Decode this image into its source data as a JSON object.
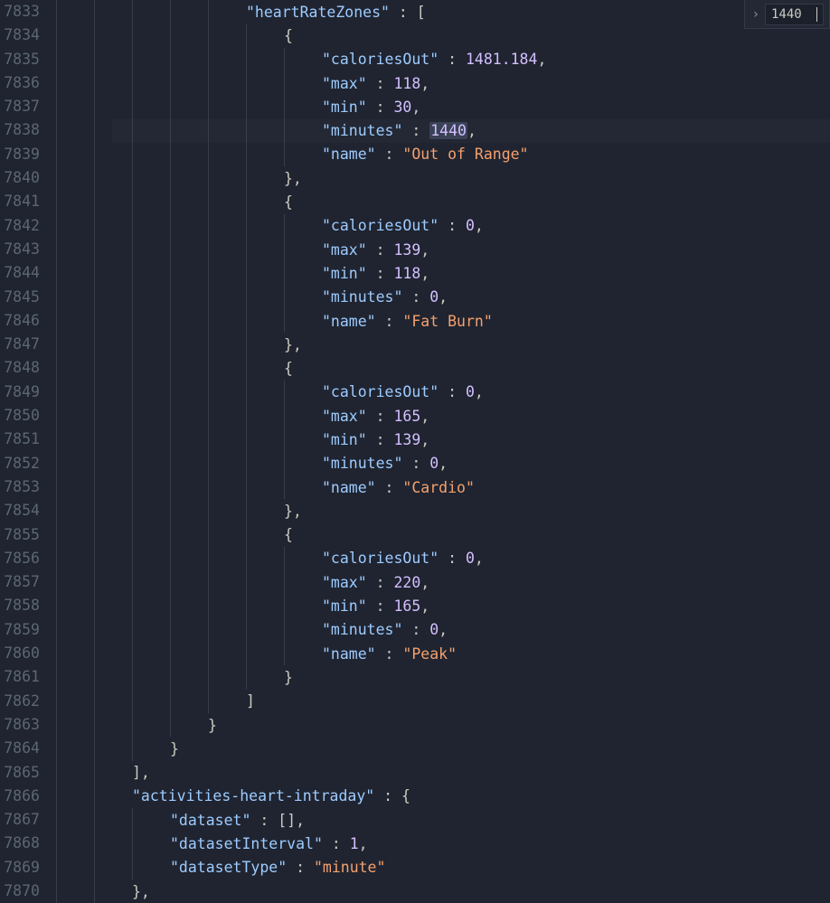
{
  "find": {
    "value": "1440"
  },
  "lines": [
    {
      "num": "7833",
      "indent": 5,
      "tokens": [
        {
          "t": "key",
          "v": "\"heartRateZones\""
        },
        {
          "t": "punc",
          "v": " : ["
        }
      ]
    },
    {
      "num": "7834",
      "indent": 6,
      "tokens": [
        {
          "t": "punc",
          "v": "{"
        }
      ]
    },
    {
      "num": "7835",
      "indent": 7,
      "tokens": [
        {
          "t": "key",
          "v": "\"caloriesOut\""
        },
        {
          "t": "punc",
          "v": " : "
        },
        {
          "t": "num",
          "v": "1481.184"
        },
        {
          "t": "punc",
          "v": ","
        }
      ]
    },
    {
      "num": "7836",
      "indent": 7,
      "tokens": [
        {
          "t": "key",
          "v": "\"max\""
        },
        {
          "t": "punc",
          "v": " : "
        },
        {
          "t": "num",
          "v": "118"
        },
        {
          "t": "punc",
          "v": ","
        }
      ]
    },
    {
      "num": "7837",
      "indent": 7,
      "tokens": [
        {
          "t": "key",
          "v": "\"min\""
        },
        {
          "t": "punc",
          "v": " : "
        },
        {
          "t": "num",
          "v": "30"
        },
        {
          "t": "punc",
          "v": ","
        }
      ]
    },
    {
      "num": "7838",
      "indent": 7,
      "highlight": true,
      "tokens": [
        {
          "t": "key",
          "v": "\"minutes\""
        },
        {
          "t": "punc",
          "v": " : "
        },
        {
          "t": "num",
          "v": "1440",
          "sel": true
        },
        {
          "t": "punc",
          "v": ","
        }
      ]
    },
    {
      "num": "7839",
      "indent": 7,
      "tokens": [
        {
          "t": "key",
          "v": "\"name\""
        },
        {
          "t": "punc",
          "v": " : "
        },
        {
          "t": "str",
          "v": "\"Out of Range\""
        }
      ]
    },
    {
      "num": "7840",
      "indent": 6,
      "tokens": [
        {
          "t": "punc",
          "v": "},"
        }
      ]
    },
    {
      "num": "7841",
      "indent": 6,
      "tokens": [
        {
          "t": "punc",
          "v": "{"
        }
      ]
    },
    {
      "num": "7842",
      "indent": 7,
      "tokens": [
        {
          "t": "key",
          "v": "\"caloriesOut\""
        },
        {
          "t": "punc",
          "v": " : "
        },
        {
          "t": "num",
          "v": "0"
        },
        {
          "t": "punc",
          "v": ","
        }
      ]
    },
    {
      "num": "7843",
      "indent": 7,
      "tokens": [
        {
          "t": "key",
          "v": "\"max\""
        },
        {
          "t": "punc",
          "v": " : "
        },
        {
          "t": "num",
          "v": "139"
        },
        {
          "t": "punc",
          "v": ","
        }
      ]
    },
    {
      "num": "7844",
      "indent": 7,
      "tokens": [
        {
          "t": "key",
          "v": "\"min\""
        },
        {
          "t": "punc",
          "v": " : "
        },
        {
          "t": "num",
          "v": "118"
        },
        {
          "t": "punc",
          "v": ","
        }
      ]
    },
    {
      "num": "7845",
      "indent": 7,
      "tokens": [
        {
          "t": "key",
          "v": "\"minutes\""
        },
        {
          "t": "punc",
          "v": " : "
        },
        {
          "t": "num",
          "v": "0"
        },
        {
          "t": "punc",
          "v": ","
        }
      ]
    },
    {
      "num": "7846",
      "indent": 7,
      "tokens": [
        {
          "t": "key",
          "v": "\"name\""
        },
        {
          "t": "punc",
          "v": " : "
        },
        {
          "t": "str",
          "v": "\"Fat Burn\""
        }
      ]
    },
    {
      "num": "7847",
      "indent": 6,
      "tokens": [
        {
          "t": "punc",
          "v": "},"
        }
      ]
    },
    {
      "num": "7848",
      "indent": 6,
      "tokens": [
        {
          "t": "punc",
          "v": "{"
        }
      ]
    },
    {
      "num": "7849",
      "indent": 7,
      "tokens": [
        {
          "t": "key",
          "v": "\"caloriesOut\""
        },
        {
          "t": "punc",
          "v": " : "
        },
        {
          "t": "num",
          "v": "0"
        },
        {
          "t": "punc",
          "v": ","
        }
      ]
    },
    {
      "num": "7850",
      "indent": 7,
      "tokens": [
        {
          "t": "key",
          "v": "\"max\""
        },
        {
          "t": "punc",
          "v": " : "
        },
        {
          "t": "num",
          "v": "165"
        },
        {
          "t": "punc",
          "v": ","
        }
      ]
    },
    {
      "num": "7851",
      "indent": 7,
      "tokens": [
        {
          "t": "key",
          "v": "\"min\""
        },
        {
          "t": "punc",
          "v": " : "
        },
        {
          "t": "num",
          "v": "139"
        },
        {
          "t": "punc",
          "v": ","
        }
      ]
    },
    {
      "num": "7852",
      "indent": 7,
      "tokens": [
        {
          "t": "key",
          "v": "\"minutes\""
        },
        {
          "t": "punc",
          "v": " : "
        },
        {
          "t": "num",
          "v": "0"
        },
        {
          "t": "punc",
          "v": ","
        }
      ]
    },
    {
      "num": "7853",
      "indent": 7,
      "tokens": [
        {
          "t": "key",
          "v": "\"name\""
        },
        {
          "t": "punc",
          "v": " : "
        },
        {
          "t": "str",
          "v": "\"Cardio\""
        }
      ]
    },
    {
      "num": "7854",
      "indent": 6,
      "tokens": [
        {
          "t": "punc",
          "v": "},"
        }
      ]
    },
    {
      "num": "7855",
      "indent": 6,
      "tokens": [
        {
          "t": "punc",
          "v": "{"
        }
      ]
    },
    {
      "num": "7856",
      "indent": 7,
      "tokens": [
        {
          "t": "key",
          "v": "\"caloriesOut\""
        },
        {
          "t": "punc",
          "v": " : "
        },
        {
          "t": "num",
          "v": "0"
        },
        {
          "t": "punc",
          "v": ","
        }
      ]
    },
    {
      "num": "7857",
      "indent": 7,
      "tokens": [
        {
          "t": "key",
          "v": "\"max\""
        },
        {
          "t": "punc",
          "v": " : "
        },
        {
          "t": "num",
          "v": "220"
        },
        {
          "t": "punc",
          "v": ","
        }
      ]
    },
    {
      "num": "7858",
      "indent": 7,
      "tokens": [
        {
          "t": "key",
          "v": "\"min\""
        },
        {
          "t": "punc",
          "v": " : "
        },
        {
          "t": "num",
          "v": "165"
        },
        {
          "t": "punc",
          "v": ","
        }
      ]
    },
    {
      "num": "7859",
      "indent": 7,
      "tokens": [
        {
          "t": "key",
          "v": "\"minutes\""
        },
        {
          "t": "punc",
          "v": " : "
        },
        {
          "t": "num",
          "v": "0"
        },
        {
          "t": "punc",
          "v": ","
        }
      ]
    },
    {
      "num": "7860",
      "indent": 7,
      "tokens": [
        {
          "t": "key",
          "v": "\"name\""
        },
        {
          "t": "punc",
          "v": " : "
        },
        {
          "t": "str",
          "v": "\"Peak\""
        }
      ]
    },
    {
      "num": "7861",
      "indent": 6,
      "tokens": [
        {
          "t": "punc",
          "v": "}"
        }
      ]
    },
    {
      "num": "7862",
      "indent": 5,
      "tokens": [
        {
          "t": "punc",
          "v": "]"
        }
      ]
    },
    {
      "num": "7863",
      "indent": 4,
      "tokens": [
        {
          "t": "punc",
          "v": "}"
        }
      ]
    },
    {
      "num": "7864",
      "indent": 3,
      "tokens": [
        {
          "t": "punc",
          "v": "}"
        }
      ]
    },
    {
      "num": "7865",
      "indent": 2,
      "tokens": [
        {
          "t": "punc",
          "v": "],"
        }
      ]
    },
    {
      "num": "7866",
      "indent": 2,
      "tokens": [
        {
          "t": "key",
          "v": "\"activities-heart-intraday\""
        },
        {
          "t": "punc",
          "v": " : {"
        }
      ]
    },
    {
      "num": "7867",
      "indent": 3,
      "tokens": [
        {
          "t": "key",
          "v": "\"dataset\""
        },
        {
          "t": "punc",
          "v": " : [],"
        }
      ]
    },
    {
      "num": "7868",
      "indent": 3,
      "tokens": [
        {
          "t": "key",
          "v": "\"datasetInterval\""
        },
        {
          "t": "punc",
          "v": " : "
        },
        {
          "t": "num",
          "v": "1"
        },
        {
          "t": "punc",
          "v": ","
        }
      ]
    },
    {
      "num": "7869",
      "indent": 3,
      "tokens": [
        {
          "t": "key",
          "v": "\"datasetType\""
        },
        {
          "t": "punc",
          "v": " : "
        },
        {
          "t": "str",
          "v": "\"minute\""
        }
      ]
    },
    {
      "num": "7870",
      "indent": 2,
      "tokens": [
        {
          "t": "punc",
          "v": "},"
        }
      ]
    }
  ]
}
